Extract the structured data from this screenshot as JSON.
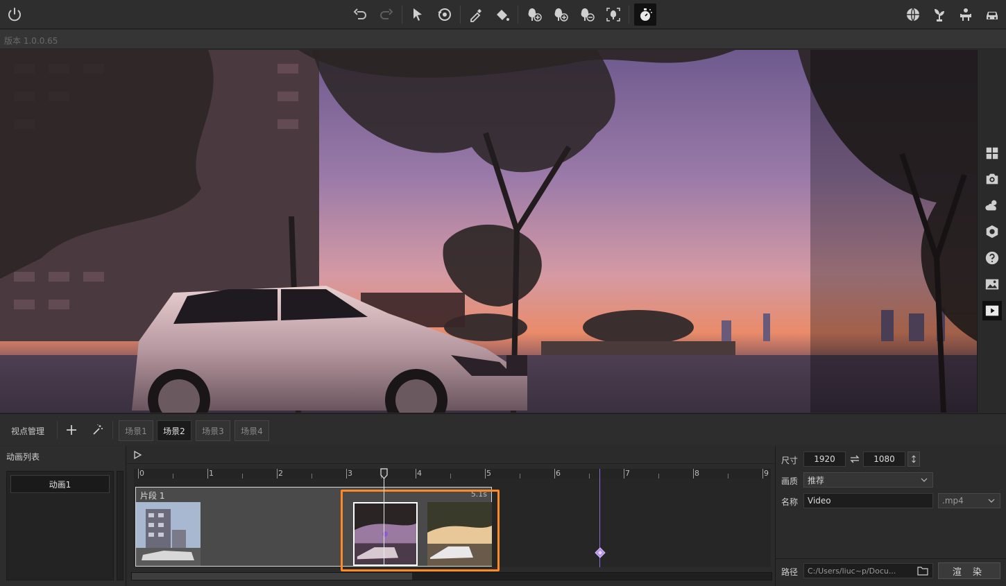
{
  "app": {
    "version_text": "版本 1.0.0.65"
  },
  "toolbar": {
    "left_icons": [
      "power-icon"
    ],
    "center_icons": [
      "undo-icon",
      "redo-icon",
      "select-arrow-icon",
      "orbit-view-icon",
      "eyedropper-icon",
      "paint-bucket-icon",
      "tree-add-icon",
      "tree-add-alt-icon",
      "tree-remove-icon",
      "tree-scan-icon",
      "timer-effect-icon"
    ],
    "right_icons": [
      "globe-icon",
      "plant-icon",
      "person-seat-icon",
      "car-icon"
    ]
  },
  "right_sidebar": {
    "icons": [
      "grid-icon",
      "camera-icon",
      "weather-icon",
      "hexagon-settings-icon",
      "help-icon",
      "image-icon",
      "video-play-icon"
    ]
  },
  "scene_bar": {
    "viewpoint_label": "视点管理",
    "tabs": [
      {
        "label": "场景1",
        "active": false
      },
      {
        "label": "场景2",
        "active": true
      },
      {
        "label": "场景3",
        "active": false
      },
      {
        "label": "场景4",
        "active": false
      }
    ]
  },
  "animation_panel": {
    "title": "动画列表",
    "items": [
      {
        "label": "动画1",
        "selected": true
      }
    ]
  },
  "timeline": {
    "ticks": [
      "0",
      "1",
      "2",
      "3",
      "4",
      "5",
      "6",
      "7",
      "8",
      "9"
    ],
    "playhead_time": 3.55,
    "marker_time": 6.65,
    "clip": {
      "name": "片段 1",
      "duration": "5.1s"
    },
    "scroll_position": 0.44
  },
  "render_settings": {
    "size_label": "尺寸",
    "width": "1920",
    "height": "1080",
    "quality_label": "画质",
    "quality_value": "推荐",
    "name_label": "名称",
    "name_value": "Video",
    "format_value": ".mp4",
    "path_label": "路径",
    "path_value": "C:/Users/liuc~p/Docu...",
    "render_button": "渲 染"
  },
  "colors": {
    "highlight": "#ff8a24",
    "marker": "#8a6cd6"
  }
}
